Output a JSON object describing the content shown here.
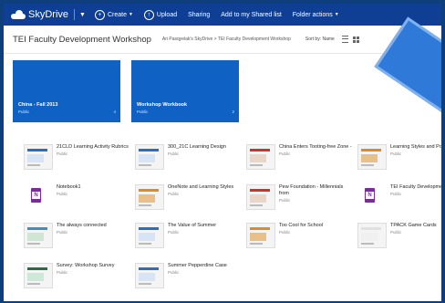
{
  "app": {
    "name": "SkyDrive"
  },
  "topbar": {
    "create_label": "Create",
    "upload_label": "Upload",
    "sharing_label": "Sharing",
    "add_shared_label": "Add to my Shared list",
    "folder_actions_label": "Folder actions"
  },
  "header": {
    "title": "TEI Faculty Development Workshop",
    "breadcrumb": "Ari Pasqyelak's SkyDrive > TEI Faculty Development Workshop",
    "sort_label": "Sort by: Name"
  },
  "folders": [
    {
      "name": "China - Fall 2013",
      "sharing": "Public",
      "count": "4"
    },
    {
      "name": "Workshop Workbook",
      "sharing": "Public",
      "count": "2"
    }
  ],
  "files": [
    {
      "name": "21CLD Learning Activity Rubrics",
      "sharing": "Public",
      "thumb": "doc"
    },
    {
      "name": "300_21C Learning Design",
      "sharing": "Public",
      "thumb": "doc"
    },
    {
      "name": "China Enters Tooting-free Zone -",
      "sharing": "Public",
      "thumb": "web"
    },
    {
      "name": "Learning Styles and PowerPoint",
      "sharing": "Public",
      "thumb": "photo"
    },
    {
      "name": "Notebook1",
      "sharing": "Public",
      "thumb": "onenote"
    },
    {
      "name": "OneNote and Learning Styles",
      "sharing": "Public",
      "thumb": "photo"
    },
    {
      "name": "Pew Foundation - Millennials from",
      "sharing": "Public",
      "thumb": "web"
    },
    {
      "name": "TEI Faculty Development",
      "sharing": "Public",
      "thumb": "onenote"
    },
    {
      "name": "The always connected",
      "sharing": "Public",
      "thumb": "map"
    },
    {
      "name": "The Value of Summer",
      "sharing": "Public",
      "thumb": "doc"
    },
    {
      "name": "Too Cool for School",
      "sharing": "Public",
      "thumb": "photo"
    },
    {
      "name": "TPACK Game Cards",
      "sharing": "Public",
      "thumb": "blank"
    },
    {
      "name": "Survey: Workshop Survey",
      "sharing": "Public",
      "thumb": "excel"
    },
    {
      "name": "Summer Pepperdine Case",
      "sharing": "Public",
      "thumb": "doc"
    }
  ],
  "colors": {
    "brand": "#0f3f94",
    "tile": "#1061c4",
    "onenote": "#7b2c9b",
    "excel": "#1e7145"
  }
}
